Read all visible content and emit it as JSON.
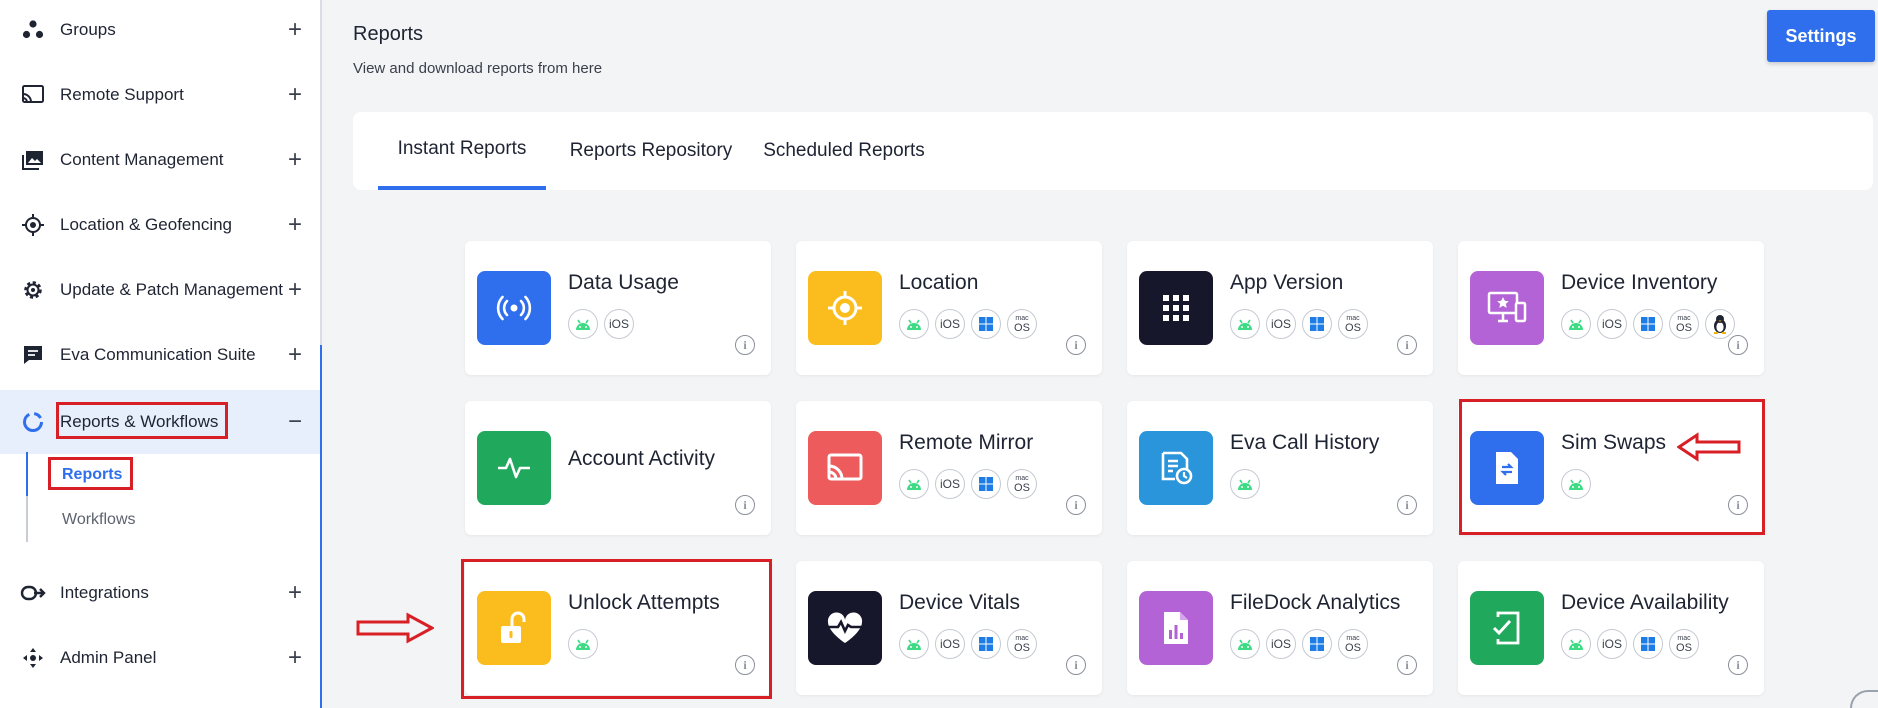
{
  "sidebar": {
    "items": [
      {
        "label": "Groups",
        "toggle": "+"
      },
      {
        "label": "Remote Support",
        "toggle": "+"
      },
      {
        "label": "Content Management",
        "toggle": "+"
      },
      {
        "label": "Location & Geofencing",
        "toggle": "+"
      },
      {
        "label": "Update & Patch Management",
        "toggle": "+"
      },
      {
        "label": "Eva Communication Suite",
        "toggle": "+"
      },
      {
        "label": "Reports & Workflows",
        "toggle": "−"
      },
      {
        "label": "Integrations",
        "toggle": "+"
      },
      {
        "label": "Admin Panel",
        "toggle": "+"
      }
    ],
    "subitems": [
      {
        "label": "Reports"
      },
      {
        "label": "Workflows"
      }
    ]
  },
  "header": {
    "title": "Reports",
    "subtitle": "View and download reports from here",
    "settings_label": "Settings"
  },
  "tabs": [
    {
      "label": "Instant Reports"
    },
    {
      "label": "Reports Repository"
    },
    {
      "label": "Scheduled Reports"
    }
  ],
  "platform_labels": {
    "ios": "iOS",
    "mac_top": "mac",
    "mac_bottom": "OS",
    "info": "i"
  },
  "reports": [
    {
      "title": "Data Usage",
      "icon": "broadcast-icon",
      "color": "#2f6fed",
      "platforms": [
        "android",
        "ios"
      ]
    },
    {
      "title": "Location",
      "icon": "crosshair-icon",
      "color": "#fbbd1e",
      "platforms": [
        "android",
        "ios",
        "windows",
        "macos"
      ]
    },
    {
      "title": "App Version",
      "icon": "app-grid-icon",
      "color": "#17172b",
      "platforms": [
        "android",
        "ios",
        "windows",
        "macos"
      ]
    },
    {
      "title": "Device Inventory",
      "icon": "monitor-star-icon",
      "color": "#b363d6",
      "platforms": [
        "android",
        "ios",
        "windows",
        "macos",
        "linux"
      ]
    },
    {
      "title": "Account Activity",
      "icon": "activity-pulse-icon",
      "color": "#20a85d",
      "platforms": []
    },
    {
      "title": "Remote Mirror",
      "icon": "cast-icon",
      "color": "#ee5b5c",
      "platforms": [
        "android",
        "ios",
        "windows",
        "macos"
      ]
    },
    {
      "title": "Eva Call History",
      "icon": "call-history-icon",
      "color": "#2a95db",
      "platforms": [
        "android"
      ]
    },
    {
      "title": "Sim Swaps",
      "icon": "sim-swap-icon",
      "color": "#2f6fed",
      "platforms": [
        "android"
      ]
    },
    {
      "title": "Unlock Attempts",
      "icon": "unlock-icon",
      "color": "#fbbd1e",
      "platforms": [
        "android"
      ]
    },
    {
      "title": "Device Vitals",
      "icon": "heartbeat-icon",
      "color": "#17172b",
      "platforms": [
        "android",
        "ios",
        "windows",
        "macos"
      ]
    },
    {
      "title": "FileDock Analytics",
      "icon": "file-chart-icon",
      "color": "#b363d6",
      "platforms": [
        "android",
        "ios",
        "windows",
        "macos"
      ]
    },
    {
      "title": "Device Availability",
      "icon": "device-check-icon",
      "color": "#20a85d",
      "platforms": [
        "android",
        "ios",
        "windows",
        "macos"
      ]
    }
  ]
}
